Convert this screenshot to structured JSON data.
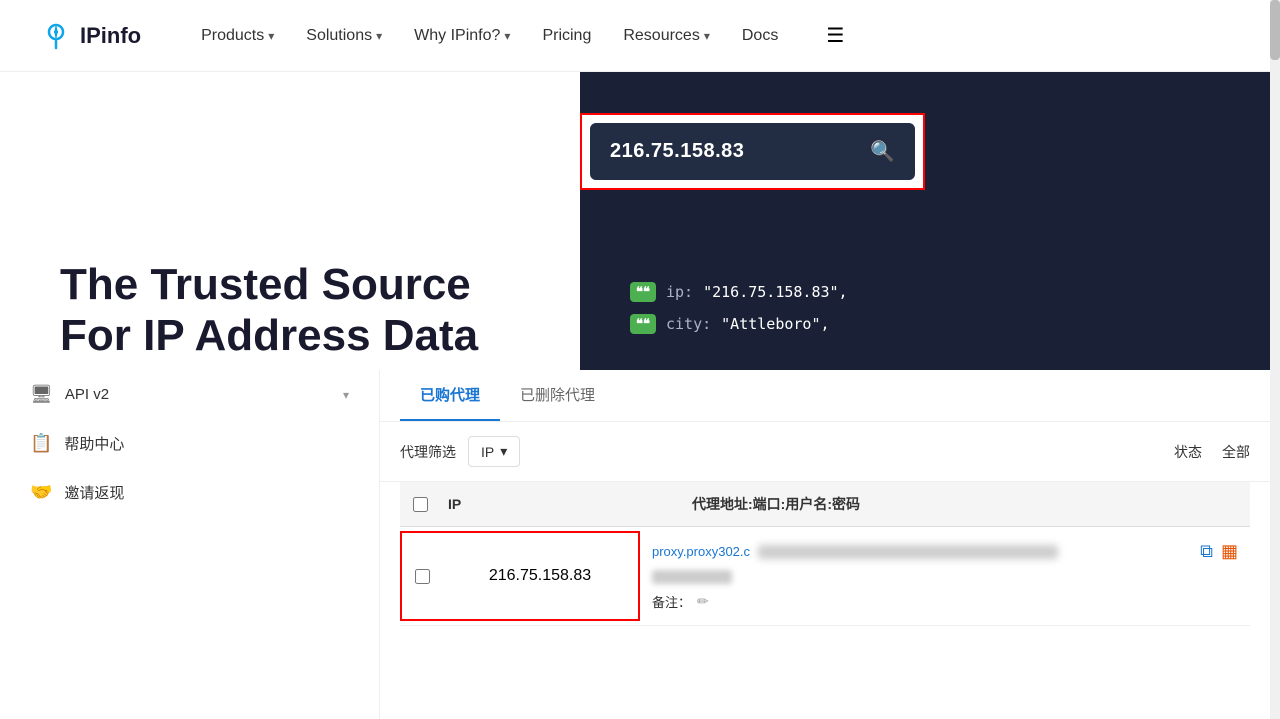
{
  "navbar": {
    "logo_text": "IPinfo",
    "nav_items": [
      {
        "label": "Products",
        "has_chevron": true
      },
      {
        "label": "Solutions",
        "has_chevron": true
      },
      {
        "label": "Why IPinfo?",
        "has_chevron": true
      },
      {
        "label": "Pricing",
        "has_chevron": false
      },
      {
        "label": "Resources",
        "has_chevron": true
      },
      {
        "label": "Docs",
        "has_chevron": false
      }
    ]
  },
  "hero": {
    "ip_value": "216.75.158.83",
    "title_line1": "The Trusted Source",
    "title_line2": "For IP Address Data",
    "json_result": {
      "ip_key": "ip:",
      "ip_val": "\"216.75.158.83\",",
      "city_key": "city:",
      "city_val": "\"Attleboro\","
    }
  },
  "sidebar": {
    "items": [
      {
        "label": "API v2",
        "icon": "📡",
        "has_expand": true
      },
      {
        "label": "帮助中心",
        "icon": "📋",
        "has_expand": false
      },
      {
        "label": "邀请返现",
        "icon": "💸",
        "has_expand": false
      }
    ]
  },
  "proxy_panel": {
    "tabs": [
      {
        "label": "已购代理",
        "active": true
      },
      {
        "label": "已删除代理",
        "active": false
      }
    ],
    "filter": {
      "label": "代理筛选",
      "select_value": "IP",
      "status_label": "状态",
      "status_value": "全部"
    },
    "table": {
      "headers": {
        "ip": "IP",
        "proxy": "代理地址:端口:用户名:密码"
      },
      "rows": [
        {
          "ip": "216.75.158.83",
          "proxy_addr": "proxy.proxy302.c",
          "remark_label": "备注："
        }
      ]
    }
  }
}
